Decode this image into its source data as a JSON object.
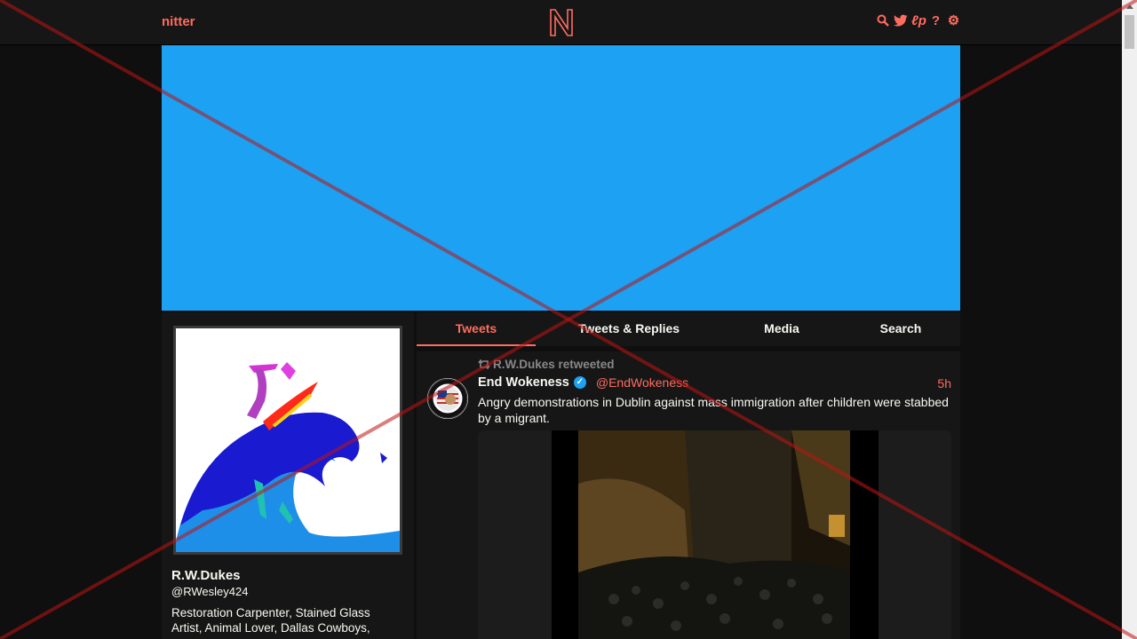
{
  "navbar": {
    "brand": "nitter",
    "logo_letter": "N",
    "icons": [
      "search-icon",
      "twitter-bird-icon",
      "liberapay-icon",
      "help-icon",
      "settings-gear-icon"
    ],
    "accent_color": "#ff6c60"
  },
  "banner": {
    "color": "#1da1f2"
  },
  "profile": {
    "fullname": "R.W.Dukes",
    "username": "@RWesley424",
    "bio": "Restoration Carpenter, Stained Glass Artist, Animal Lover,  Dallas Cowboys,"
  },
  "tabs": [
    {
      "label": "Tweets",
      "active": true
    },
    {
      "label": "Tweets & Replies",
      "active": false
    },
    {
      "label": "Media",
      "active": false
    },
    {
      "label": "Search",
      "active": false
    }
  ],
  "tweet": {
    "retweet_header": "R.W.Dukes retweeted",
    "fullname": "End Wokeness",
    "verified": true,
    "username": "@EndWokeness",
    "date": "5h",
    "text": "Angry demonstrations in Dublin against mass immigration after children were stabbed by a migrant."
  }
}
